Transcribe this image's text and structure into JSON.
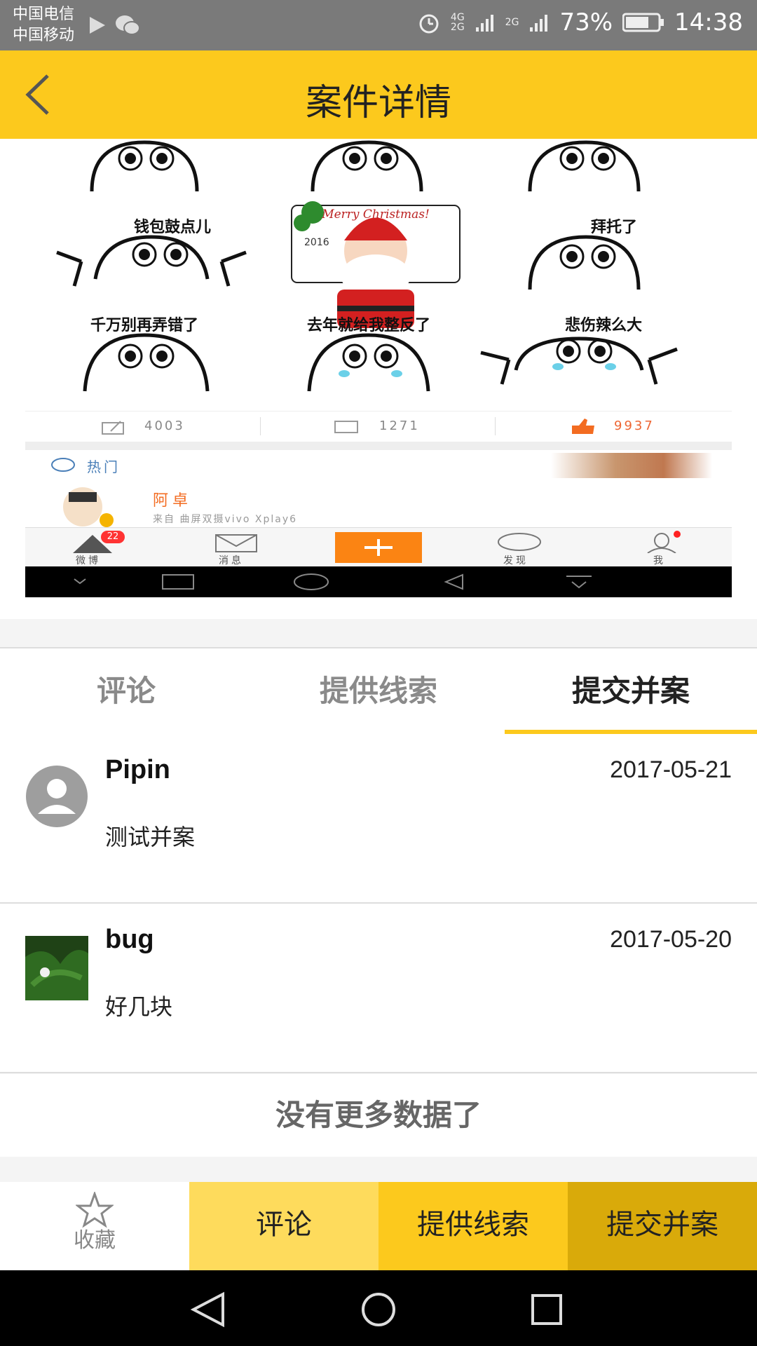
{
  "status": {
    "carrier1": "中国电信",
    "carrier2": "中国移动",
    "network1": "4G",
    "network2": "2G",
    "network3": "2G",
    "battery": "73%",
    "time": "14:38"
  },
  "appbar": {
    "title": "案件详情"
  },
  "screenshot": {
    "captions": [
      "钱包鼓点儿",
      "拜托了",
      "千万别再弄错了",
      "去年就给我整反了",
      "悲伤辣么大"
    ],
    "card_text": "Merry Christmas!",
    "card_year": "2016",
    "stats": {
      "repost": "4003",
      "comments": "1271",
      "likes": "9937"
    },
    "hot": "热门",
    "user": "阿卓",
    "source": "来自  曲屏双摄vivo  Xplay6",
    "tabbar": {
      "home": "微博",
      "badge": "22",
      "messages": "消息",
      "discover": "发现",
      "me": "我"
    }
  },
  "tabs": [
    {
      "label": "评论"
    },
    {
      "label": "提供线索"
    },
    {
      "label": "提交并案"
    }
  ],
  "items": [
    {
      "name": "Pipin",
      "date": "2017-05-21",
      "text": "测试并案"
    },
    {
      "name": "bug",
      "date": "2017-05-20",
      "text": "好几块"
    }
  ],
  "no_more": "没有更多数据了",
  "actions": {
    "favorite": "收藏",
    "comment": "评论",
    "clue": "提供线索",
    "merge": "提交并案"
  },
  "colors": {
    "accent": "#fcc91d",
    "comment_bg": "#fedb5c",
    "clue_bg": "#fcc91d",
    "merge_bg": "#d9aa0a",
    "weibo_orange": "#fb8413"
  }
}
